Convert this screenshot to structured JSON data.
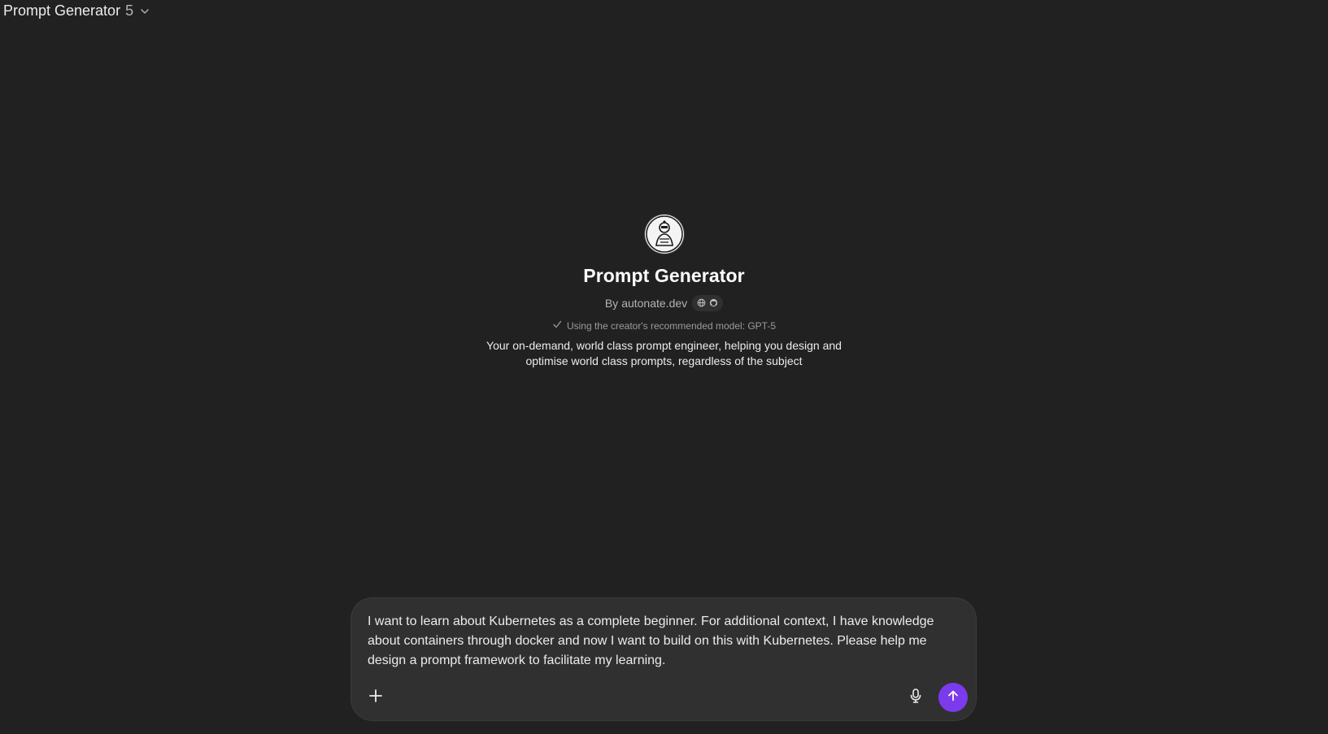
{
  "header": {
    "model_name": "Prompt Generator",
    "model_version": "5",
    "dropdown_icon": "chevron-down-icon"
  },
  "gpt": {
    "title": "Prompt Generator",
    "byline_prefix": "By",
    "author": "autonate.dev",
    "links": [
      "globe-icon",
      "github-icon"
    ],
    "model_note": "Using the creator's recommended model: GPT-5",
    "description": "Your on-demand, world class prompt engineer, helping you design and optimise world class prompts, regardless of the subject"
  },
  "composer": {
    "text": "I want to learn about Kubernetes as a complete beginner. For additional context, I have knowledge about containers through docker and now I want to build on this with Kubernetes. Please help me design a prompt framework to facilitate my learning.",
    "add_icon": "plus-icon",
    "mic_icon": "microphone-icon",
    "send_icon": "arrow-up-icon",
    "send_color": "#7c3aed"
  }
}
